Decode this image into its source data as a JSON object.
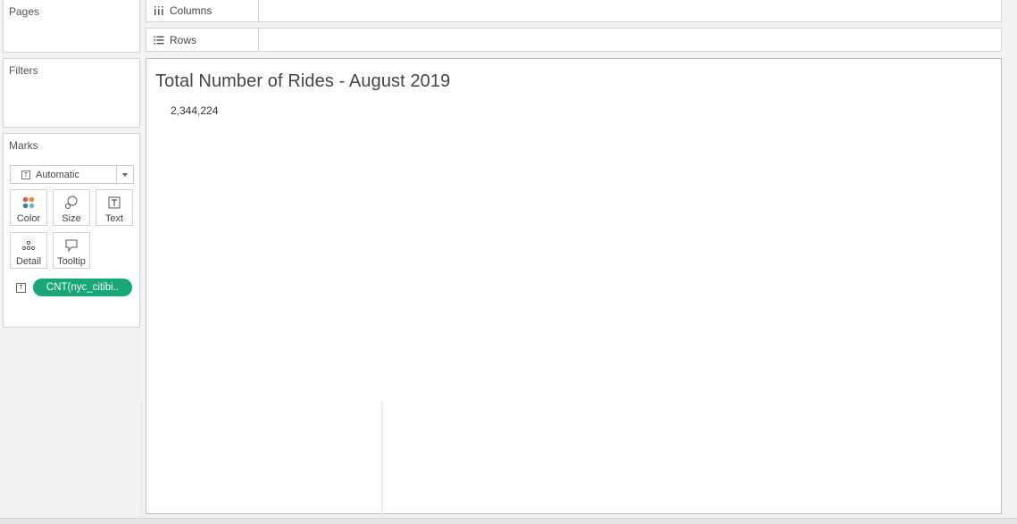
{
  "sidebar": {
    "pages_title": "Pages",
    "filters_title": "Filters",
    "marks": {
      "title": "Marks",
      "mark_type": "Automatic",
      "buttons": {
        "color": "Color",
        "size": "Size",
        "text": "Text",
        "detail": "Detail",
        "tooltip": "Tooltip"
      },
      "pill_label": "CNT(nyc_citibi.."
    }
  },
  "shelves": {
    "columns_label": "Columns",
    "rows_label": "Rows"
  },
  "view": {
    "title": "Total Number of Rides - August 2019",
    "value": "2,344,224"
  },
  "colors": {
    "pill": "#18a779",
    "color_dots": [
      "#e15759",
      "#f28e2b",
      "#4e79a7",
      "#76b7b2"
    ]
  }
}
